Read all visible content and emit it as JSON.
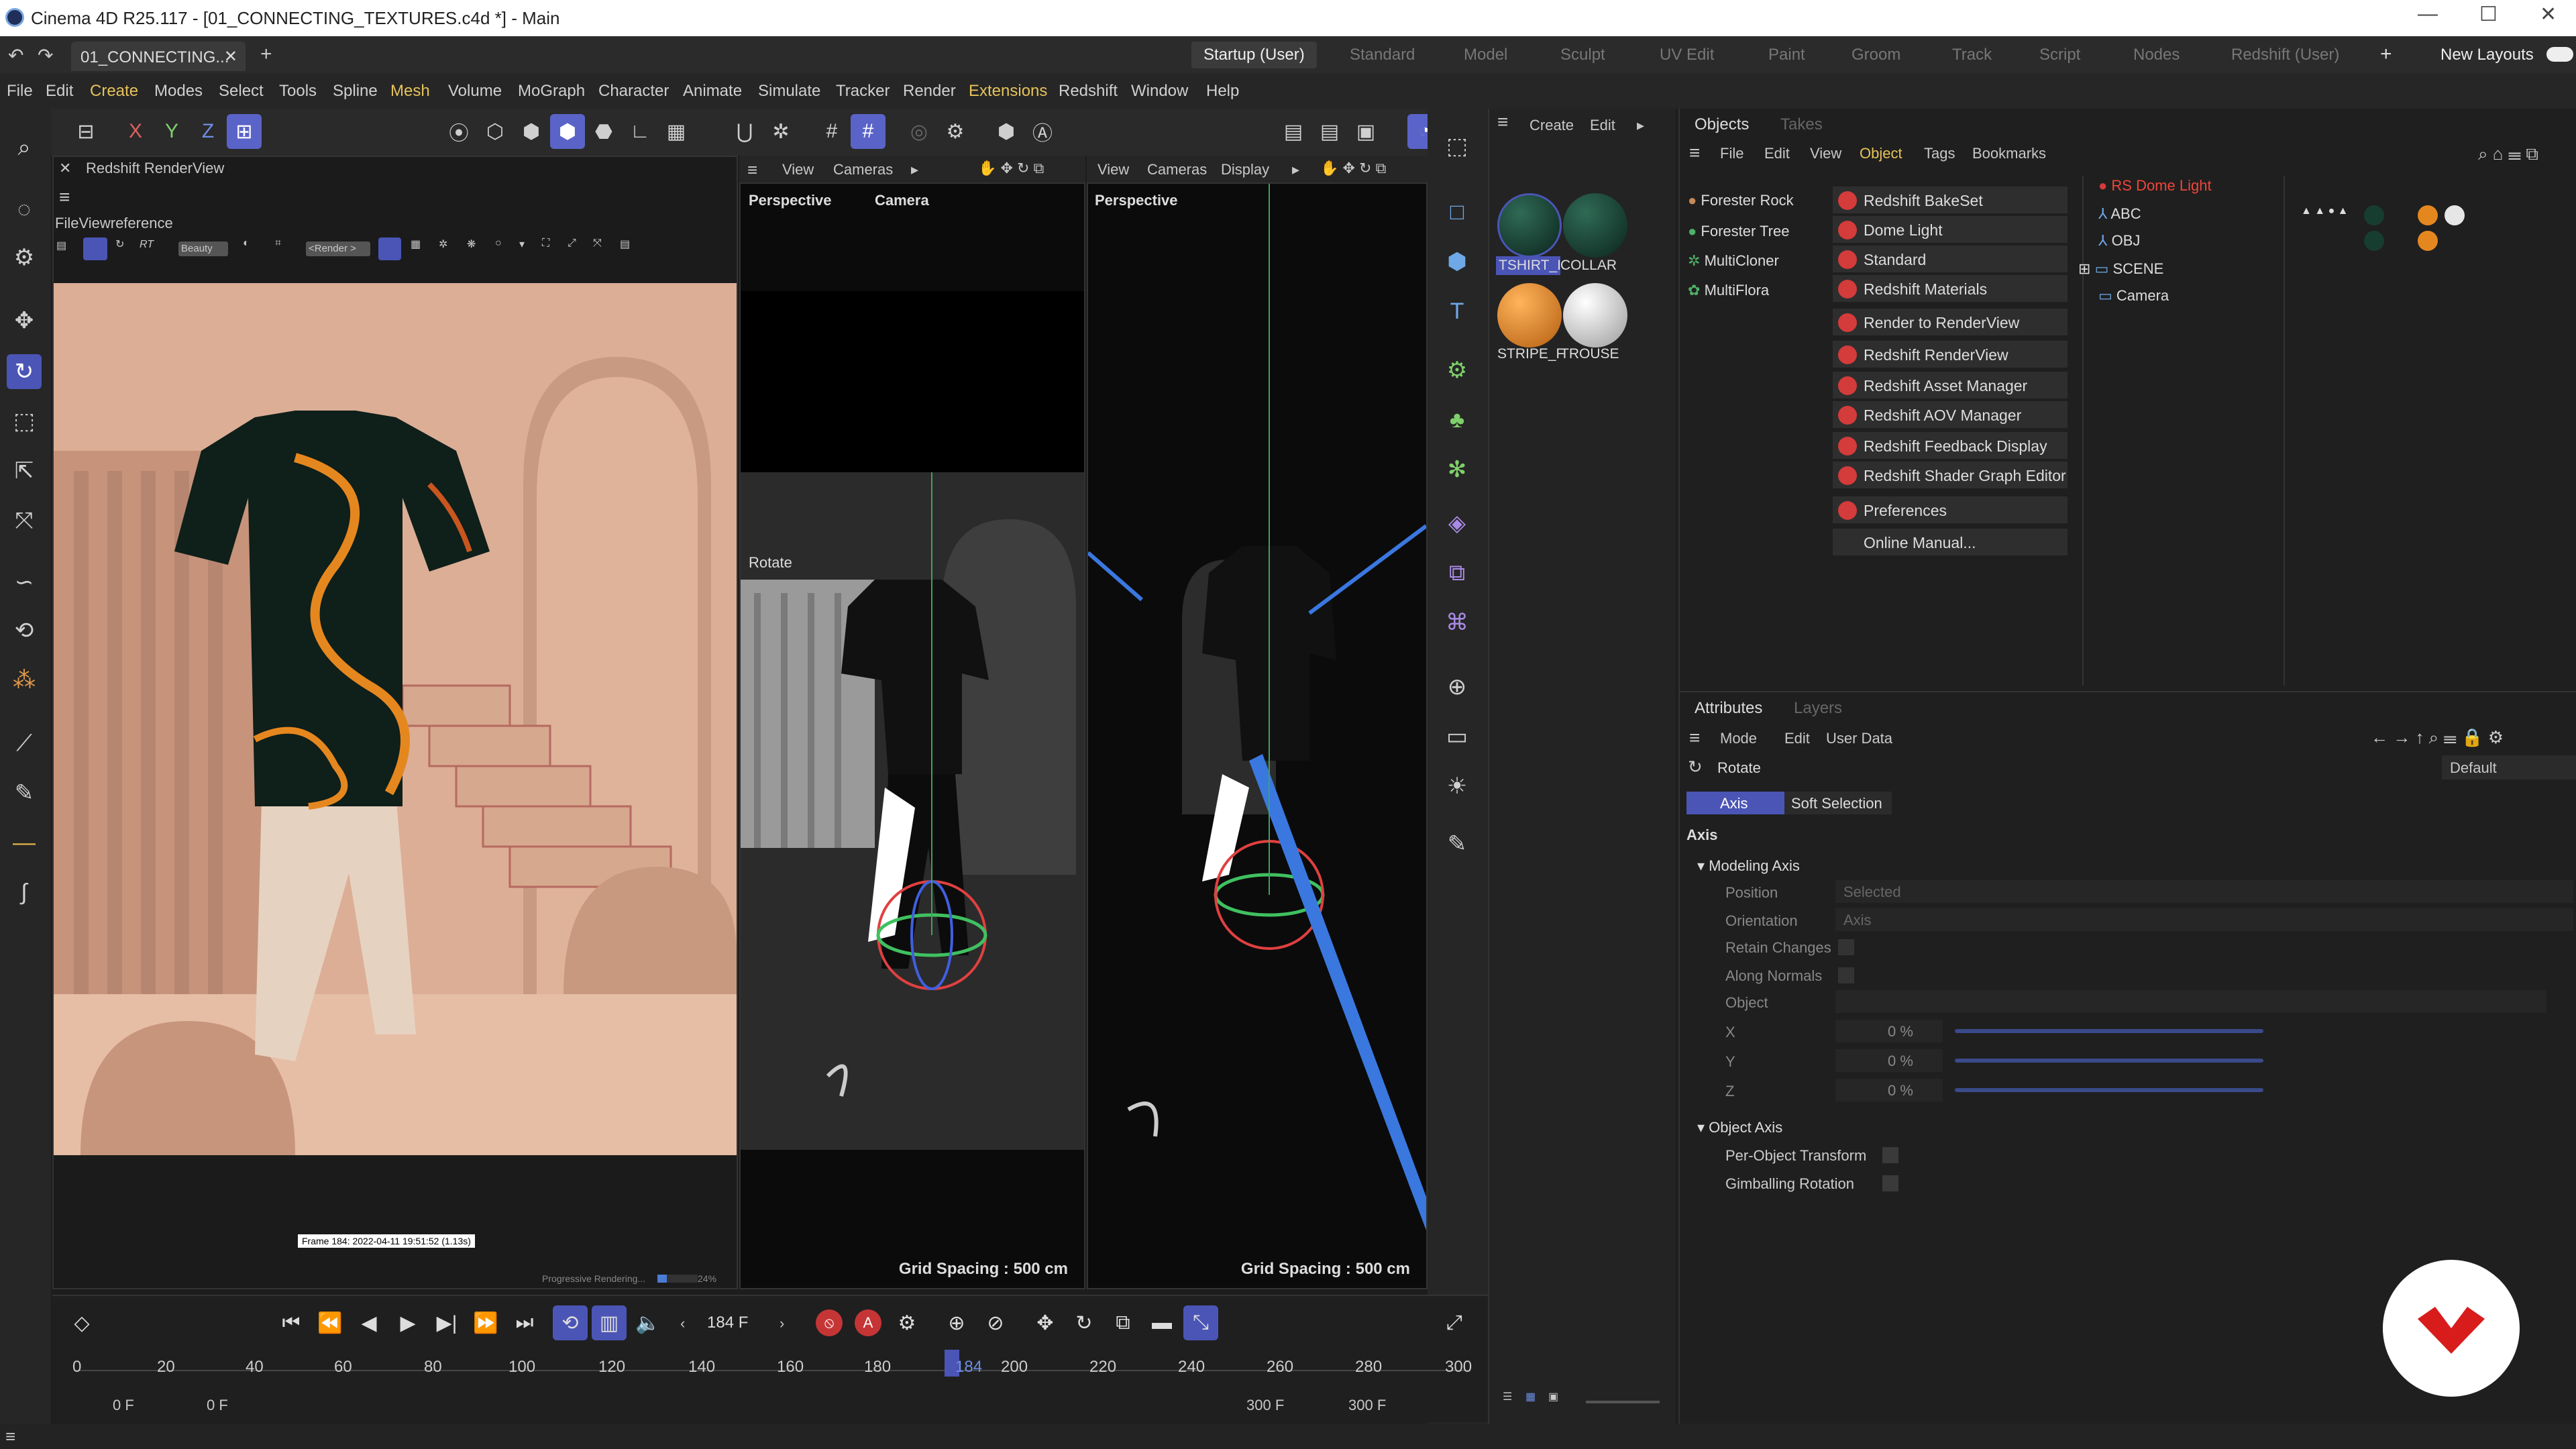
{
  "window": {
    "title": "Cinema 4D R25.117 - [01_CONNECTING_TEXTURES.c4d *] - Main"
  },
  "tabs": {
    "doc": "01_CONNECTING...",
    "layouts": [
      "Startup (User)",
      "Standard",
      "Model",
      "Sculpt",
      "UV Edit",
      "Paint",
      "Groom",
      "Track",
      "Script",
      "Nodes",
      "Redshift (User)"
    ],
    "new_layouts": "New Layouts"
  },
  "menu": [
    "File",
    "Edit",
    "Create",
    "Modes",
    "Select",
    "Tools",
    "Spline",
    "Mesh",
    "Volume",
    "MoGraph",
    "Character",
    "Animate",
    "Simulate",
    "Tracker",
    "Render",
    "Extensions",
    "Redshift",
    "Window",
    "Help"
  ],
  "renderview": {
    "title": "Redshift RenderView",
    "menu": "FileViewreference",
    "beauty": "Beauty",
    "render_btn": "<Render >",
    "frame_info": "Frame 184: 2022-04-11 19:51:52 (1.13s)",
    "progress": "Progressive Rendering...",
    "progress_pct": "24%"
  },
  "viewport1": {
    "menu_view": "View",
    "menu_cameras": "Cameras",
    "name": "Perspective",
    "camera": "Camera",
    "tool": "Rotate",
    "grid": "Grid Spacing : 500 cm"
  },
  "viewport2": {
    "menu_view": "View",
    "menu_cameras": "Cameras",
    "menu_display": "Display",
    "name": "Perspective",
    "grid": "Grid Spacing : 500 cm"
  },
  "materials": {
    "create": "Create",
    "edit": "Edit",
    "items": [
      {
        "name": "TSHIRT_I",
        "color": "#173d30"
      },
      {
        "name": "COLLAR",
        "color": "#173d30"
      },
      {
        "name": "STRIPE_F",
        "color": "#e5871f"
      },
      {
        "name": "TROUSE",
        "color": "#e6e6e6"
      }
    ]
  },
  "objects_panel": {
    "tabs": [
      "Objects",
      "Takes"
    ],
    "menu": [
      "File",
      "Edit",
      "View",
      "Object",
      "Tags",
      "Bookmarks"
    ],
    "plugins": [
      "Forester Rock",
      "Forester Tree",
      "MultiCloner",
      "MultiFlora"
    ],
    "redshift_menu": [
      "Redshift BakeSet",
      "Dome Light",
      "Standard",
      "Redshift Materials",
      "Render to RenderView",
      "Redshift RenderView",
      "Redshift Asset Manager",
      "Redshift AOV Manager",
      "Redshift Feedback Display",
      "Redshift Shader Graph Editor",
      "Preferences",
      "Online Manual..."
    ],
    "tree": [
      "RS Dome Light",
      "ABC",
      "OBJ",
      "SCENE",
      "Camera"
    ]
  },
  "attributes": {
    "tabs": [
      "Attributes",
      "Layers"
    ],
    "menu": [
      "Mode",
      "Edit",
      "User Data"
    ],
    "tool": "Rotate",
    "preset": "Default",
    "subtabs": [
      "Axis",
      "Soft Selection"
    ],
    "section": "Axis",
    "modeling_axis": "Modeling Axis",
    "position_label": "Position",
    "position_value": "Selected",
    "orientation_label": "Orientation",
    "orientation_value": "Axis",
    "retain": "Retain Changes",
    "normals": "Along Normals",
    "object": "Object",
    "x_label": "X",
    "x_val": "0 %",
    "y_label": "Y",
    "y_val": "0 %",
    "z_label": "Z",
    "z_val": "0 %",
    "object_axis": "Object Axis",
    "per_object": "Per-Object Transform",
    "gimbal": "Gimballing Rotation"
  },
  "timeline": {
    "current_frame": "184 F",
    "ticks": [
      "0",
      "20",
      "40",
      "60",
      "80",
      "100",
      "120",
      "140",
      "160",
      "180",
      "200",
      "220",
      "240",
      "260",
      "280",
      "300"
    ],
    "marker": "184",
    "start": "0 F",
    "start2": "0 F",
    "end": "300 F",
    "end2": "300 F"
  }
}
